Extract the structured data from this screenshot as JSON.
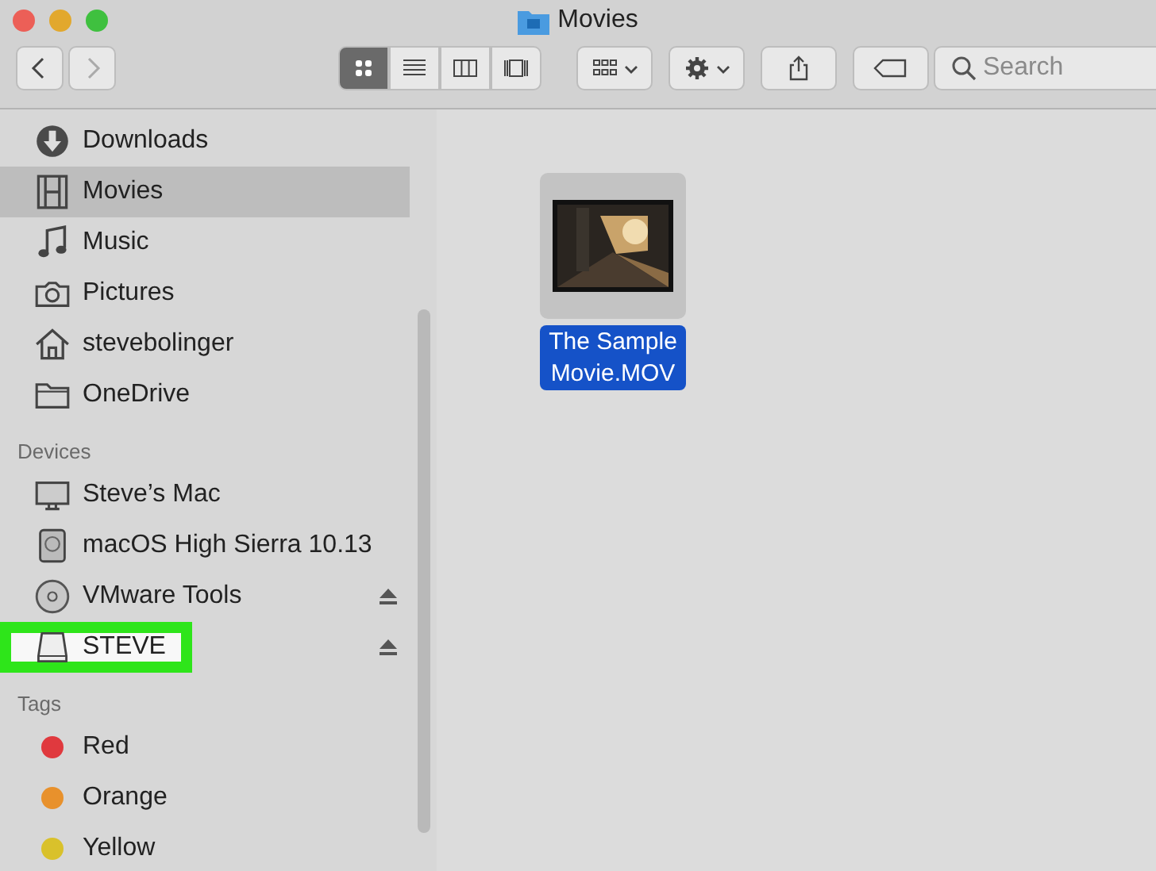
{
  "window": {
    "title": "Movies"
  },
  "toolbar": {
    "view_modes": [
      {
        "kind": "icons",
        "selected": true
      },
      {
        "kind": "list",
        "selected": false
      },
      {
        "kind": "columns",
        "selected": false
      },
      {
        "kind": "gallery",
        "selected": false
      }
    ],
    "search": {
      "placeholder": "Search"
    }
  },
  "sidebar": {
    "sections": [
      {
        "items": [
          {
            "label": "Downloads",
            "selected": false
          },
          {
            "label": "Movies",
            "selected": true
          },
          {
            "label": "Music",
            "selected": false
          },
          {
            "label": "Pictures",
            "selected": false
          },
          {
            "label": "stevebolinger",
            "selected": false
          },
          {
            "label": "OneDrive",
            "selected": false
          }
        ]
      },
      {
        "heading": "Devices",
        "items": [
          {
            "label": "Steve’s Mac",
            "selected": false
          },
          {
            "label": "macOS High Sierra 10.13",
            "selected": false
          },
          {
            "label": "VMware Tools",
            "selected": false,
            "ejectable": true
          },
          {
            "label": "STEVE",
            "selected": false,
            "ejectable": true,
            "highlighted": true
          }
        ]
      },
      {
        "heading": "Tags",
        "items": [
          {
            "label": "Red",
            "color": "#e0393e",
            "selected": false
          },
          {
            "label": "Orange",
            "color": "#e8912c",
            "selected": false
          },
          {
            "label": "Yellow",
            "color": "#d9c12b",
            "selected": false
          }
        ]
      }
    ]
  },
  "files": [
    {
      "name": "The Sample Movie.MOV",
      "kind": "picture",
      "selected": true
    }
  ]
}
